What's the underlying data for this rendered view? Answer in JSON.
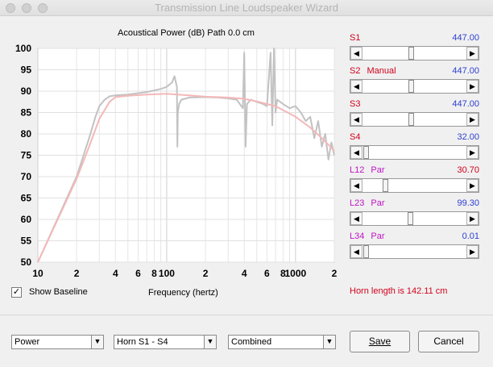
{
  "window": {
    "title": "Transmission Line Loudspeaker Wizard"
  },
  "chart_header": "Acoustical Power (dB)   Path 0.0 cm",
  "chart_data": {
    "type": "line",
    "title": "Acoustical Power (dB)   Path 0.0 cm",
    "xlabel": "Frequency (hertz)",
    "ylabel": "",
    "x_scale": "log",
    "xlim": [
      10,
      2000
    ],
    "ylim": [
      50,
      100
    ],
    "yticks": [
      100,
      95,
      90,
      85,
      80,
      75,
      70,
      65,
      60,
      55,
      50
    ],
    "xticks": [
      "10",
      "2",
      "4",
      "6",
      "8",
      "100",
      "2",
      "4",
      "6",
      "8",
      "1000",
      "2"
    ],
    "grid": true,
    "series": [
      {
        "color": "#c2c2c2",
        "x": [
          10,
          20,
          25,
          28,
          30,
          33,
          36,
          40,
          50,
          70,
          90,
          100,
          110,
          115,
          120,
          121,
          122,
          125,
          130,
          150,
          200,
          250,
          300,
          350,
          390,
          400,
          410,
          420,
          450,
          500,
          560,
          600,
          640,
          660,
          680,
          700,
          720,
          800,
          900,
          1000,
          1100,
          1200,
          1300,
          1400,
          1500,
          1600,
          1700,
          1800,
          1900,
          2000
        ],
        "y": [
          50,
          70,
          79,
          84,
          86.5,
          88,
          88.8,
          89,
          89.2,
          89.8,
          90.5,
          91,
          92,
          93.5,
          91,
          77,
          85,
          87,
          88,
          88.5,
          88.6,
          88.5,
          88.3,
          88,
          86,
          99,
          77,
          87,
          88,
          87.5,
          87,
          86.5,
          99,
          82,
          100,
          85,
          88,
          87,
          86,
          86.5,
          85,
          83,
          84,
          79,
          83,
          77,
          80,
          74,
          78,
          75
        ]
      },
      {
        "color": "#f4b8b8",
        "x": [
          10,
          20,
          25,
          30,
          36,
          40,
          50,
          70,
          100,
          150,
          200,
          300,
          400,
          500,
          700,
          1000,
          1300,
          1600,
          1800,
          2000
        ],
        "y": [
          50,
          69.5,
          77,
          83.5,
          87.5,
          88.6,
          88.9,
          89.2,
          89.4,
          89,
          88.7,
          88.5,
          88.2,
          87.6,
          86.5,
          84,
          81.5,
          79,
          77.5,
          76
        ]
      }
    ]
  },
  "params": [
    {
      "name": "S1",
      "mode": "",
      "value": "447.00",
      "fraction": 0.46
    },
    {
      "name": "S2",
      "mode": "Manual",
      "value": "447.00",
      "fraction": 0.46
    },
    {
      "name": "S3",
      "mode": "",
      "value": "447.00",
      "fraction": 0.46
    },
    {
      "name": "S4",
      "mode": "",
      "value": "32.00",
      "fraction": 0.0
    },
    {
      "name": "L12",
      "mode": "Par",
      "value": "30.70",
      "fraction": 0.2
    },
    {
      "name": "L23",
      "mode": "Par",
      "value": "99.30",
      "fraction": 0.45
    },
    {
      "name": "L34",
      "mode": "Par",
      "value": "0.01",
      "fraction": 0.0
    }
  ],
  "baseline": {
    "label": "Show Baseline",
    "checked": true,
    "check_glyph": "✓"
  },
  "horn_length": "Horn length is 142.11 cm",
  "dropdowns": {
    "mode": {
      "value": "Power"
    },
    "range": {
      "value": "Horn S1 - S4"
    },
    "combine": {
      "value": "Combined"
    }
  },
  "buttons": {
    "save": "Save",
    "cancel": "Cancel"
  },
  "colors": {
    "red": "#d0021b",
    "blue": "#2b3fd1",
    "magenta": "#c014c6"
  }
}
